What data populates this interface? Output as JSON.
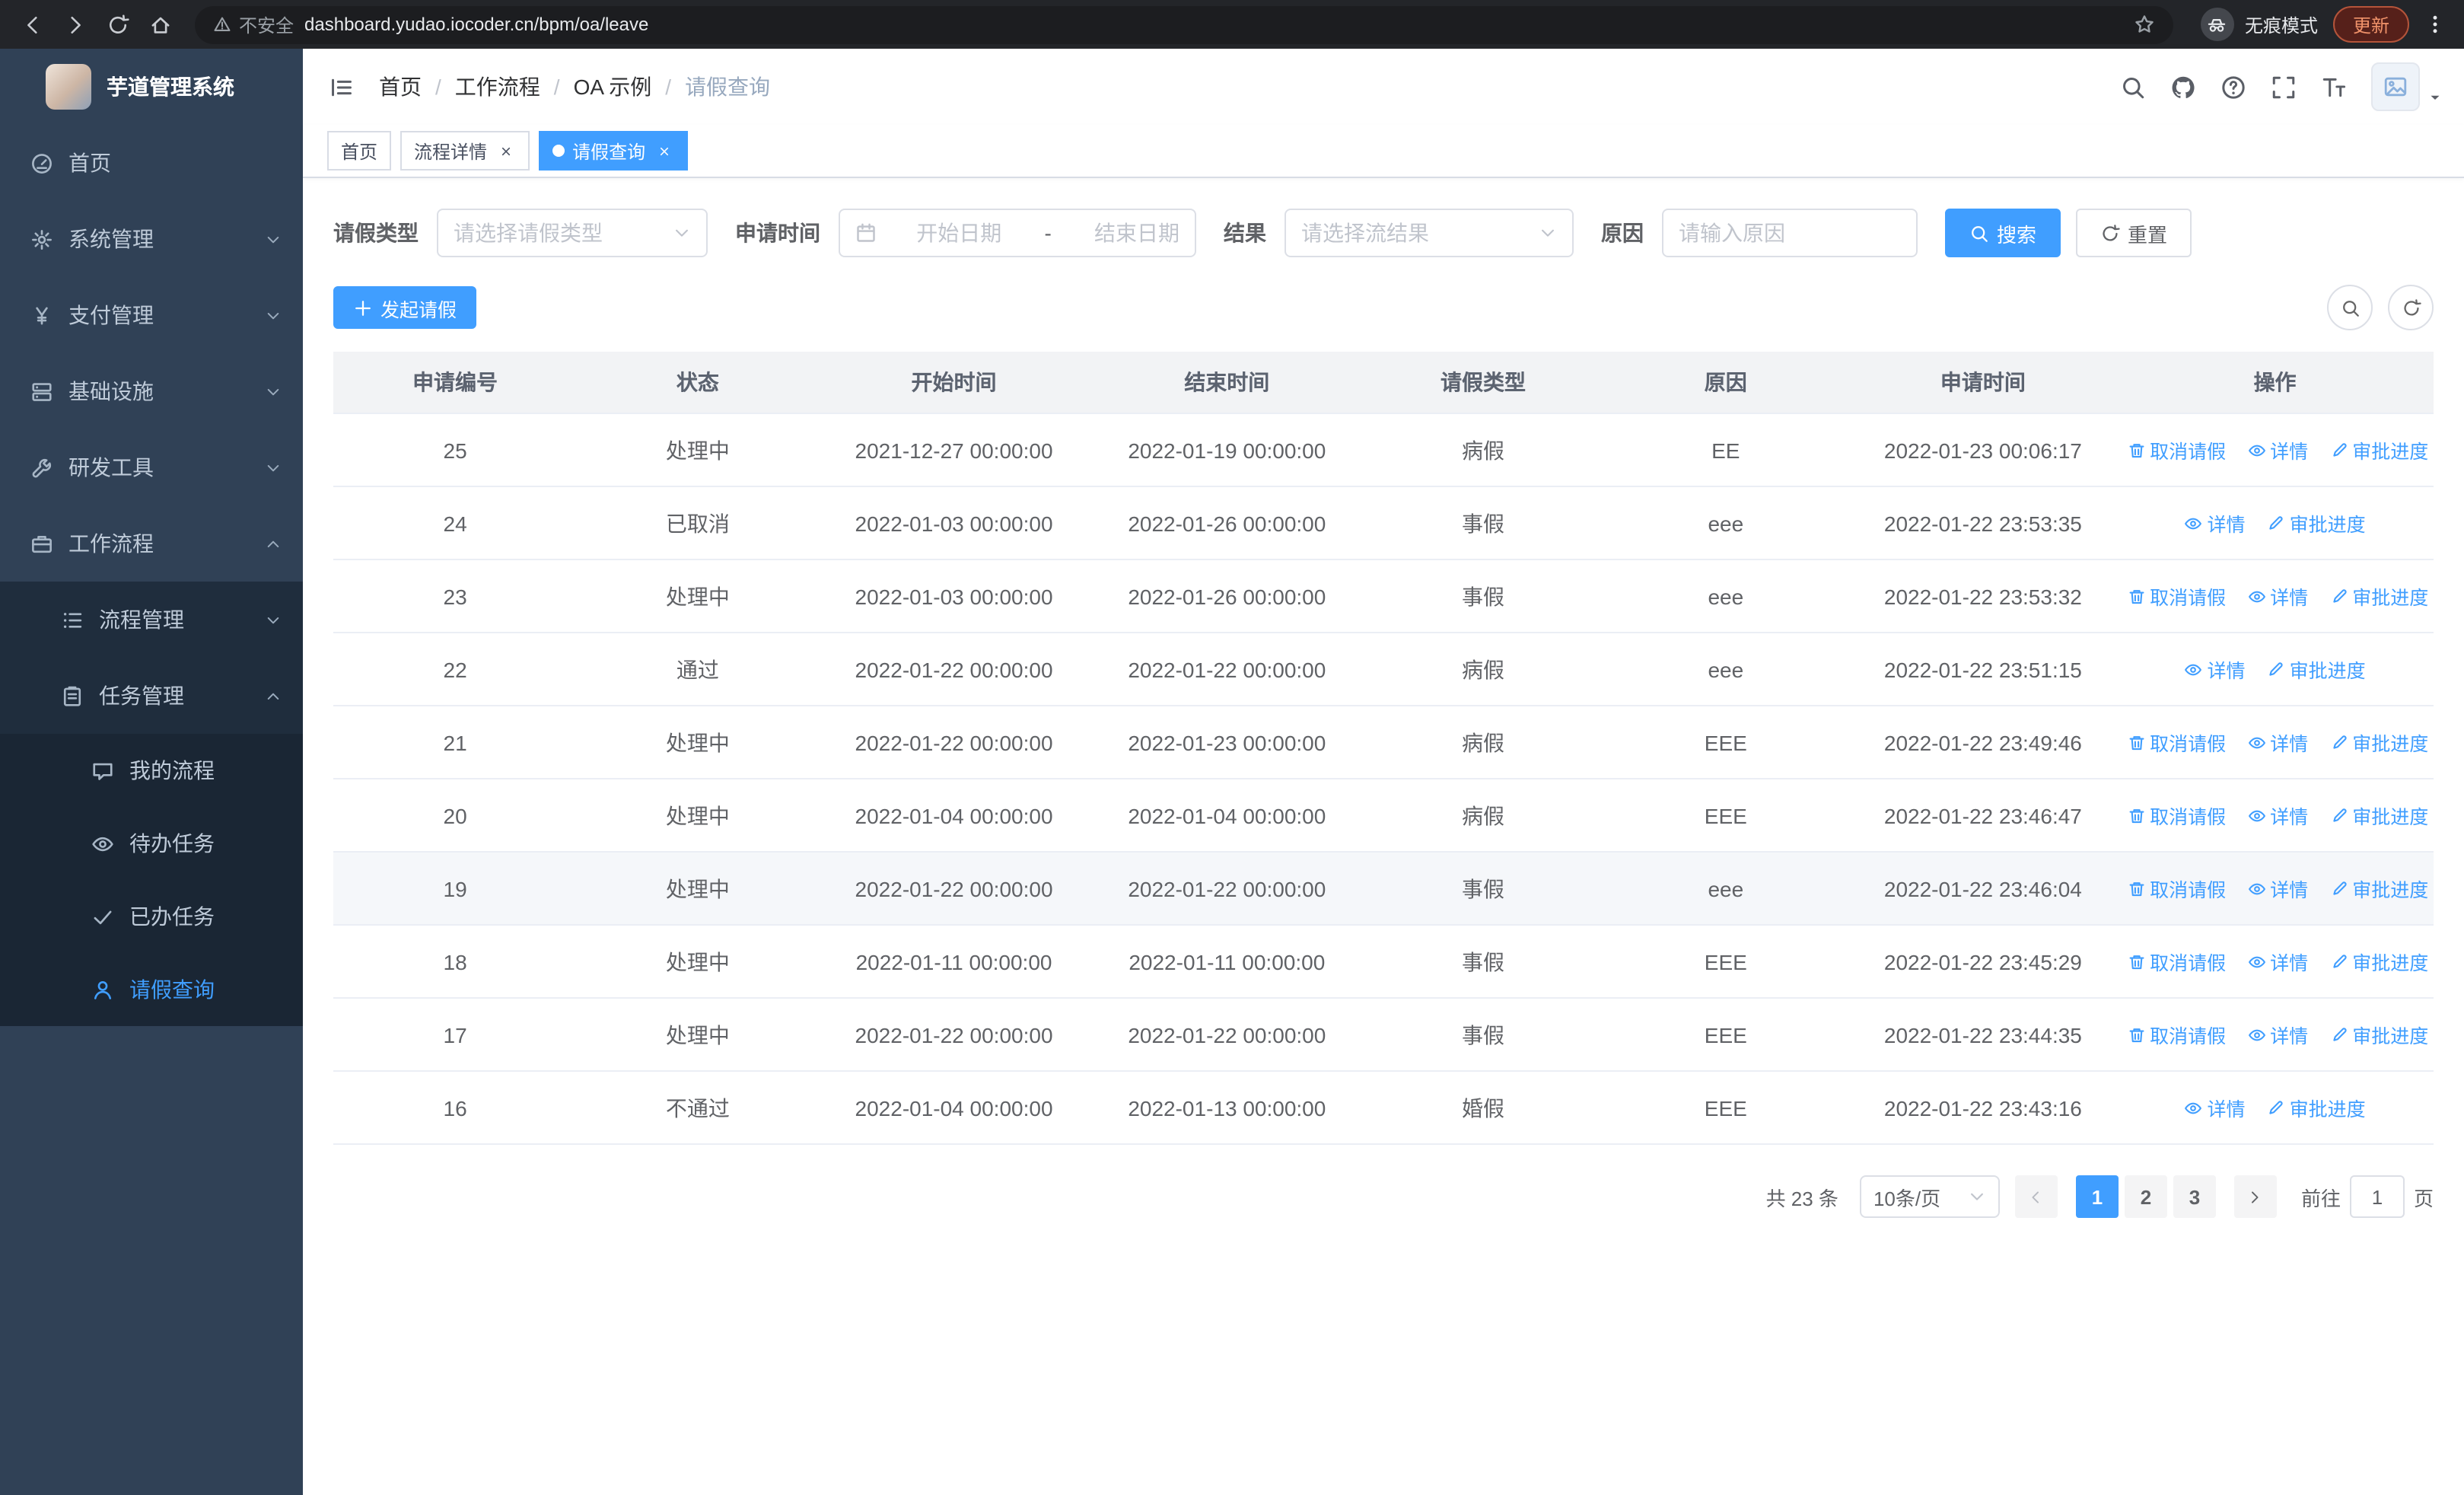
{
  "browser": {
    "security_label": "不安全",
    "url": "dashboard.yudao.iocoder.cn/bpm/oa/leave",
    "incognito_label": "无痕模式",
    "update_label": "更新"
  },
  "sidebar": {
    "app_title": "芋道管理系统",
    "items": [
      {
        "id": "home",
        "label": "首页",
        "icon": "dashboard-icon",
        "level": 1
      },
      {
        "id": "system",
        "label": "系统管理",
        "icon": "gear-icon",
        "level": 1,
        "chevron": "down"
      },
      {
        "id": "payment",
        "label": "支付管理",
        "icon": "yen-icon",
        "level": 1,
        "chevron": "down"
      },
      {
        "id": "infrastructure",
        "label": "基础设施",
        "icon": "server-icon",
        "level": 1,
        "chevron": "down"
      },
      {
        "id": "devtools",
        "label": "研发工具",
        "icon": "wrench-icon",
        "level": 1,
        "chevron": "down"
      },
      {
        "id": "workflow",
        "label": "工作流程",
        "icon": "briefcase-icon",
        "level": 1,
        "chevron": "up"
      },
      {
        "id": "process-mgmt",
        "label": "流程管理",
        "icon": "list-icon",
        "level": 2,
        "chevron": "down"
      },
      {
        "id": "task-mgmt",
        "label": "任务管理",
        "icon": "clipboard-icon",
        "level": 2,
        "chevron": "up"
      },
      {
        "id": "my-process",
        "label": "我的流程",
        "icon": "chat-icon",
        "level": 3
      },
      {
        "id": "todo-task",
        "label": "待办任务",
        "icon": "eye-icon",
        "level": 3
      },
      {
        "id": "done-task",
        "label": "已办任务",
        "icon": "check-icon",
        "level": 3
      },
      {
        "id": "leave-query",
        "label": "请假查询",
        "icon": "user-icon",
        "level": 3,
        "active": true
      }
    ]
  },
  "header": {
    "breadcrumb": [
      "首页",
      "工作流程",
      "OA 示例",
      "请假查询"
    ]
  },
  "tabs": [
    {
      "id": "home",
      "label": "首页",
      "closable": false,
      "active": false
    },
    {
      "id": "process-detail",
      "label": "流程详情",
      "closable": true,
      "active": false
    },
    {
      "id": "leave-query",
      "label": "请假查询",
      "closable": true,
      "active": true
    }
  ],
  "filters": {
    "fields": [
      {
        "type": "select",
        "name": "leave-type-select",
        "label": "请假类型",
        "placeholder": "请选择请假类型"
      },
      {
        "type": "daterange",
        "name": "apply-time-range",
        "label": "申请时间",
        "start_placeholder": "开始日期",
        "separator": "-",
        "end_placeholder": "结束日期"
      },
      {
        "type": "select",
        "name": "result-select",
        "label": "结果",
        "placeholder": "请选择流结果"
      },
      {
        "type": "text",
        "name": "reason-input",
        "label": "原因",
        "placeholder": "请输入原因"
      }
    ],
    "search_label": "搜索",
    "reset_label": "重置"
  },
  "toolbar": {
    "create_label": "发起请假"
  },
  "table": {
    "columns": [
      {
        "key": "id",
        "label": "申请编号"
      },
      {
        "key": "status",
        "label": "状态"
      },
      {
        "key": "start",
        "label": "开始时间"
      },
      {
        "key": "end",
        "label": "结束时间"
      },
      {
        "key": "type",
        "label": "请假类型"
      },
      {
        "key": "reason",
        "label": "原因"
      },
      {
        "key": "applied",
        "label": "申请时间"
      },
      {
        "key": "actions",
        "label": "操作"
      }
    ],
    "action_labels": {
      "cancel": "取消请假",
      "detail": "详情",
      "progress": "审批进度"
    },
    "action_icons": {
      "cancel": "delete-icon",
      "detail": "eye-icon",
      "progress": "edit-icon"
    },
    "rows": [
      {
        "id": "25",
        "status": "处理中",
        "start": "2021-12-27 00:00:00",
        "end": "2022-01-19 00:00:00",
        "type": "病假",
        "reason": "EE",
        "applied": "2022-01-23 00:06:17",
        "actions": [
          "cancel",
          "detail",
          "progress"
        ]
      },
      {
        "id": "24",
        "status": "已取消",
        "start": "2022-01-03 00:00:00",
        "end": "2022-01-26 00:00:00",
        "type": "事假",
        "reason": "eee",
        "applied": "2022-01-22 23:53:35",
        "actions": [
          "detail",
          "progress"
        ]
      },
      {
        "id": "23",
        "status": "处理中",
        "start": "2022-01-03 00:00:00",
        "end": "2022-01-26 00:00:00",
        "type": "事假",
        "reason": "eee",
        "applied": "2022-01-22 23:53:32",
        "actions": [
          "cancel",
          "detail",
          "progress"
        ]
      },
      {
        "id": "22",
        "status": "通过",
        "start": "2022-01-22 00:00:00",
        "end": "2022-01-22 00:00:00",
        "type": "病假",
        "reason": "eee",
        "applied": "2022-01-22 23:51:15",
        "actions": [
          "detail",
          "progress"
        ]
      },
      {
        "id": "21",
        "status": "处理中",
        "start": "2022-01-22 00:00:00",
        "end": "2022-01-23 00:00:00",
        "type": "病假",
        "reason": "EEE",
        "applied": "2022-01-22 23:49:46",
        "actions": [
          "cancel",
          "detail",
          "progress"
        ]
      },
      {
        "id": "20",
        "status": "处理中",
        "start": "2022-01-04 00:00:00",
        "end": "2022-01-04 00:00:00",
        "type": "病假",
        "reason": "EEE",
        "applied": "2022-01-22 23:46:47",
        "actions": [
          "cancel",
          "detail",
          "progress"
        ]
      },
      {
        "id": "19",
        "status": "处理中",
        "start": "2022-01-22 00:00:00",
        "end": "2022-01-22 00:00:00",
        "type": "事假",
        "reason": "eee",
        "applied": "2022-01-22 23:46:04",
        "actions": [
          "cancel",
          "detail",
          "progress"
        ],
        "highlighted": true
      },
      {
        "id": "18",
        "status": "处理中",
        "start": "2022-01-11 00:00:00",
        "end": "2022-01-11 00:00:00",
        "type": "事假",
        "reason": "EEE",
        "applied": "2022-01-22 23:45:29",
        "actions": [
          "cancel",
          "detail",
          "progress"
        ]
      },
      {
        "id": "17",
        "status": "处理中",
        "start": "2022-01-22 00:00:00",
        "end": "2022-01-22 00:00:00",
        "type": "事假",
        "reason": "EEE",
        "applied": "2022-01-22 23:44:35",
        "actions": [
          "cancel",
          "detail",
          "progress"
        ]
      },
      {
        "id": "16",
        "status": "不通过",
        "start": "2022-01-04 00:00:00",
        "end": "2022-01-13 00:00:00",
        "type": "婚假",
        "reason": "EEE",
        "applied": "2022-01-22 23:43:16",
        "actions": [
          "detail",
          "progress"
        ]
      }
    ]
  },
  "pagination": {
    "total_label": "共 23 条",
    "page_size": "10条/页",
    "pages": [
      "1",
      "2",
      "3"
    ],
    "active_page": "1",
    "goto_label": "前往",
    "goto_value": "1",
    "unit_label": "页"
  },
  "colors": {
    "primary": "#409eff",
    "sidebar_bg": "#304156",
    "submenu_bg": "#1f2d3d"
  }
}
